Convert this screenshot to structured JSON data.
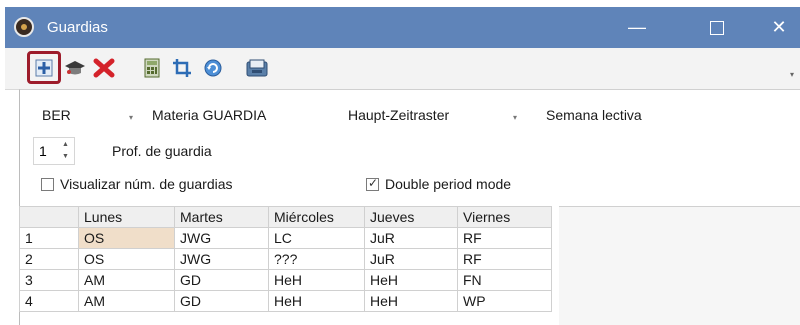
{
  "window": {
    "title": "Guardias",
    "minimize_glyph": "—",
    "close_glyph": "✕"
  },
  "toolbar": {
    "buttons": [
      {
        "name": "assign-icon"
      },
      {
        "name": "graduation-cap-icon"
      },
      {
        "name": "delete-icon"
      },
      {
        "name": "calculator-icon"
      },
      {
        "name": "crop-icon"
      },
      {
        "name": "refresh-icon"
      },
      {
        "name": "export-icon"
      }
    ],
    "overflow_glyph": "▾"
  },
  "controls": {
    "period_select": "BER",
    "materia_label": "Materia GUARDIA",
    "timetable_select": "Haupt-Zeitraster",
    "week_label": "Semana lectiva",
    "spinner_value": "1",
    "prof_label": "Prof. de guardia",
    "show_count_label": "Visualizar núm. de guardias",
    "show_count_checked": false,
    "double_period_label": "Double period mode",
    "double_period_checked": true,
    "dropdown_glyph": "▾",
    "spin_up_glyph": "▲",
    "spin_down_glyph": "▼",
    "check_glyph": "✓"
  },
  "grid": {
    "columns": [
      "",
      "Lunes",
      "Martes",
      "Miércoles",
      "Jueves",
      "Viernes"
    ],
    "rows": [
      [
        "1",
        "OS",
        "JWG",
        "LC",
        "JuR",
        "RF"
      ],
      [
        "2",
        "OS",
        "JWG",
        "???",
        "JuR",
        "RF"
      ],
      [
        "3",
        "AM",
        "GD",
        "HeH",
        "HeH",
        "FN"
      ],
      [
        "4",
        "AM",
        "GD",
        "HeH",
        "HeH",
        "WP"
      ]
    ]
  }
}
